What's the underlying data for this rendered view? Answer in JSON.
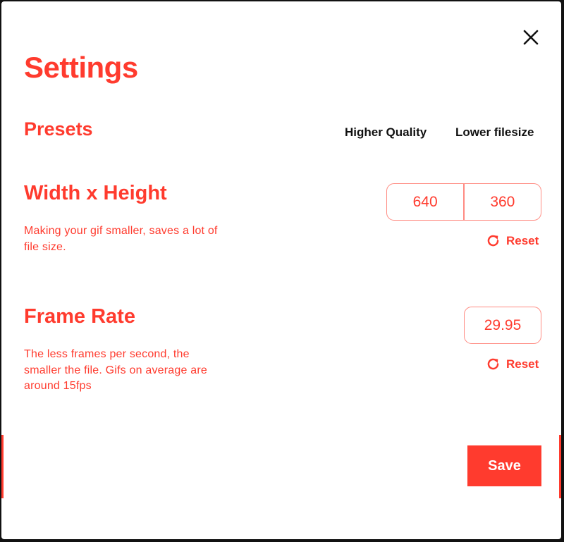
{
  "dialog": {
    "title": "Settings",
    "close_icon": "close-icon"
  },
  "presets": {
    "label": "Presets",
    "options": [
      "Higher Quality",
      "Lower filesize"
    ]
  },
  "dimensions": {
    "title": "Width x Height",
    "description": "Making your gif smaller, saves a lot of file size.",
    "width": "640",
    "height": "360",
    "reset_label": "Reset",
    "reset_icon": "reset-icon"
  },
  "frame_rate": {
    "title": "Frame Rate",
    "description": "The less frames per second, the smaller the file. Gifs on average are around 15fps",
    "value": "29.95",
    "reset_label": "Reset",
    "reset_icon": "reset-icon"
  },
  "footer": {
    "save_label": "Save"
  },
  "colors": {
    "accent": "#ff3b2e",
    "accent_light": "#ff8b82",
    "text_dark": "#111111",
    "background": "#ffffff"
  }
}
